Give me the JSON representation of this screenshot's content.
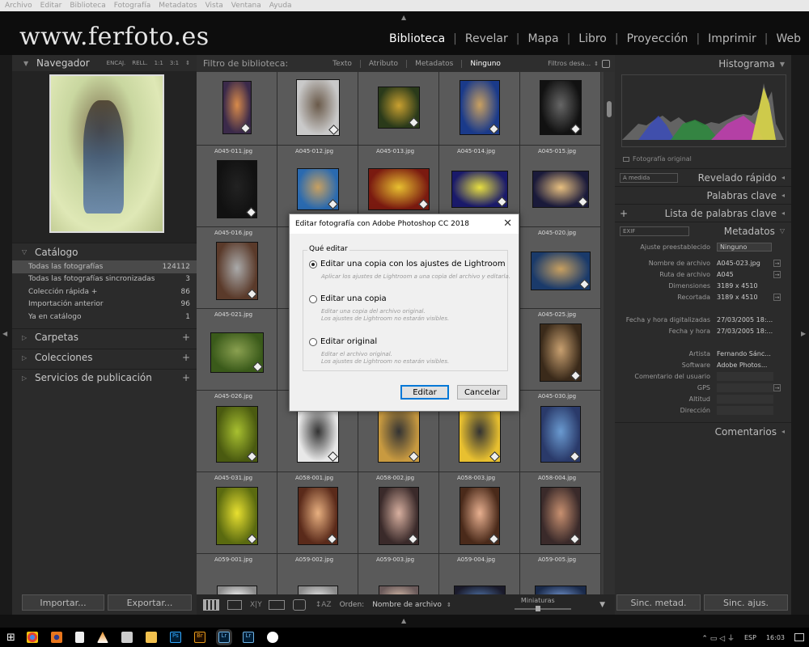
{
  "menubar": [
    "Archivo",
    "Editar",
    "Biblioteca",
    "Fotografía",
    "Metadatos",
    "Vista",
    "Ventana",
    "Ayuda"
  ],
  "brand": "www.ferfoto.es",
  "modules": [
    "Biblioteca",
    "Revelar",
    "Mapa",
    "Libro",
    "Proyección",
    "Imprimir",
    "Web"
  ],
  "navigator": {
    "title": "Navegador",
    "modes": [
      "ENCAJ.",
      "RELL.",
      "1:1",
      "3:1"
    ]
  },
  "catalog": {
    "title": "Catálogo",
    "items": [
      {
        "label": "Todas las fotografías",
        "count": "124112"
      },
      {
        "label": "Todas las fotografías sincronizadas",
        "count": "3"
      },
      {
        "label": "Colección rápida +",
        "count": "86"
      },
      {
        "label": "Importación anterior",
        "count": "96"
      },
      {
        "label": "Ya en catálogo",
        "count": "1"
      }
    ]
  },
  "left_sections": [
    "Carpetas",
    "Colecciones",
    "Servicios de publicación"
  ],
  "left_buttons": {
    "import": "Importar...",
    "export": "Exportar..."
  },
  "filter": {
    "label": "Filtro de biblioteca:",
    "tabs": [
      "Texto",
      "Atributo",
      "Metadatos",
      "Ninguno"
    ],
    "presets": "Filtros desa..."
  },
  "grid_filenames": [
    "",
    "",
    "",
    "",
    "",
    "A045-011.jpg",
    "A045-012.jpg",
    "A045-013.jpg",
    "A045-014.jpg",
    "A045-015.jpg",
    "A045-016.jpg",
    "",
    "",
    "",
    "A045-020.jpg",
    "A045-021.jpg",
    "",
    "",
    "",
    "A045-025.jpg",
    "A045-026.jpg",
    "",
    "",
    "",
    "A045-030.jpg",
    "A045-031.jpg",
    "A058-001.jpg",
    "A058-002.jpg",
    "A058-003.jpg",
    "A058-004.jpg",
    "A059-001.jpg",
    "A059-002.jpg",
    "A059-003.jpg",
    "A059-004.jpg",
    "A059-005.jpg"
  ],
  "dialog": {
    "title": "Editar fotografía con Adobe Photoshop CC 2018",
    "legend": "Qué editar",
    "options": [
      {
        "label": "Editar una copia con los ajustes de Lightroom",
        "hint": "Aplicar los ajustes de Lightroom a una copia del archivo y editarla.",
        "selected": true
      },
      {
        "label": "Editar una copia",
        "hint": "Editar una copia del archivo original.\nLos ajustes de Lightroom no estarán visibles.",
        "selected": false
      },
      {
        "label": "Editar original",
        "hint": "Editar el archivo original.\nLos ajustes de Lightroom no estarán visibles.",
        "selected": false
      }
    ],
    "edit": "Editar",
    "cancel": "Cancelar"
  },
  "bottombar": {
    "sort_label": "Orden:",
    "sort_value": "Nombre de archivo",
    "thumb_label": "Miniaturas"
  },
  "right": {
    "histogram": "Histograma",
    "original": "Fotografía original",
    "quick_develop": "Revelado rápido",
    "quick_preset": "A medida",
    "keywords": "Palabras clave",
    "keyword_list": "Lista de palabras clave",
    "metadata": "Metadatos",
    "meta_preset": "EXIF",
    "preset_label": "Ajuste preestablecido",
    "preset_value": "Ninguno",
    "meta_rows": [
      {
        "label": "Nombre de archivo",
        "value": "A045-023.jpg"
      },
      {
        "label": "Ruta de archivo",
        "value": "A045"
      },
      {
        "label": "Dimensiones",
        "value": "3189 x 4510"
      },
      {
        "label": "Recortada",
        "value": "3189 x 4510"
      },
      {
        "label": "",
        "value": ""
      },
      {
        "label": "Fecha y hora digitalizadas",
        "value": "27/03/2005 18:..."
      },
      {
        "label": "Fecha y hora",
        "value": "27/03/2005 18:..."
      },
      {
        "label": "",
        "value": ""
      },
      {
        "label": "Artista",
        "value": "Fernando Sánc..."
      },
      {
        "label": "Software",
        "value": "Adobe Photos..."
      },
      {
        "label": "Comentario del usuario",
        "value": ""
      },
      {
        "label": "GPS",
        "value": ""
      },
      {
        "label": "Altitud",
        "value": ""
      },
      {
        "label": "Dirección",
        "value": ""
      }
    ],
    "comments": "Comentarios",
    "sync_meta": "Sinc. metad.",
    "sync_settings": "Sinc. ajus."
  },
  "taskbar": {
    "lang": "ESP",
    "time": "16:03"
  }
}
